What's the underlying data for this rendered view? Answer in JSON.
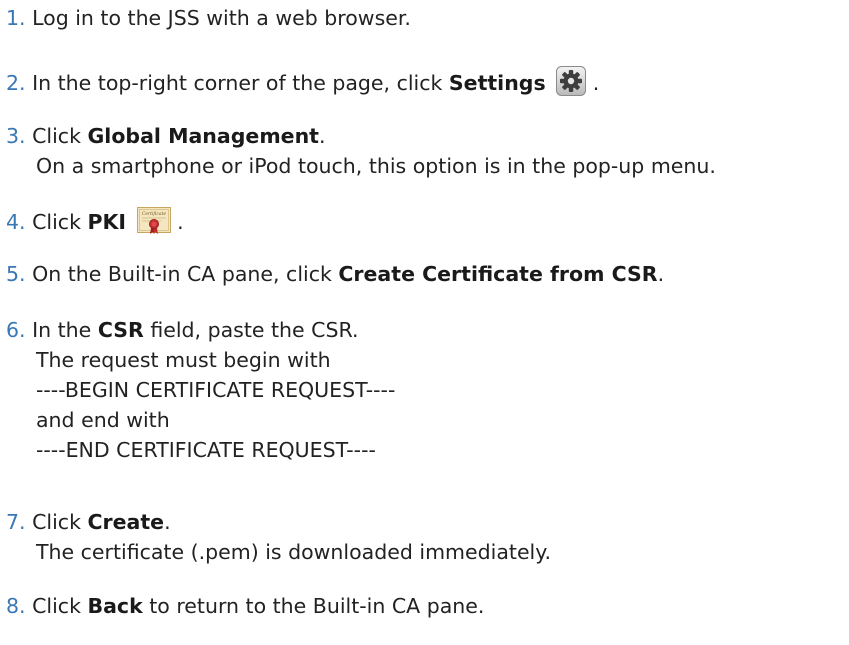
{
  "steps": [
    {
      "num": "1.",
      "text": "Log in to the JSS with a web browser."
    },
    {
      "num": "2.",
      "pre": "In the top-right corner of the page, click ",
      "bold": "Settings",
      "icon": "gear-icon",
      "post": " ."
    },
    {
      "num": "3.",
      "pre": "Click ",
      "bold": "Global Management",
      "post": ".",
      "lines": [
        "On a smartphone or iPod touch, this option is in the pop-up menu."
      ]
    },
    {
      "num": "4.",
      "pre": "Click ",
      "bold": "PKI",
      "icon": "certificate-icon",
      "icon_text": "Certificate",
      "post": " ."
    },
    {
      "num": "5.",
      "pre": "On the Built-in CA pane, click ",
      "bold": "Create Certificate from CSR",
      "post": "."
    },
    {
      "num": "6.",
      "pre": "In the ",
      "bold": "CSR",
      "post": " field, paste the CSR.",
      "lines": [
        "The request must begin with",
        "----BEGIN CERTIFICATE REQUEST----",
        "and end with",
        "----END CERTIFICATE REQUEST----"
      ]
    },
    {
      "num": "7.",
      "pre": "Click ",
      "bold": "Create",
      "post": ".",
      "lines": [
        "The certificate (.pem) is downloaded immediately."
      ]
    },
    {
      "num": "8.",
      "pre": "Click ",
      "bold": "Back",
      "post": " to return to the Built-in CA pane."
    }
  ]
}
